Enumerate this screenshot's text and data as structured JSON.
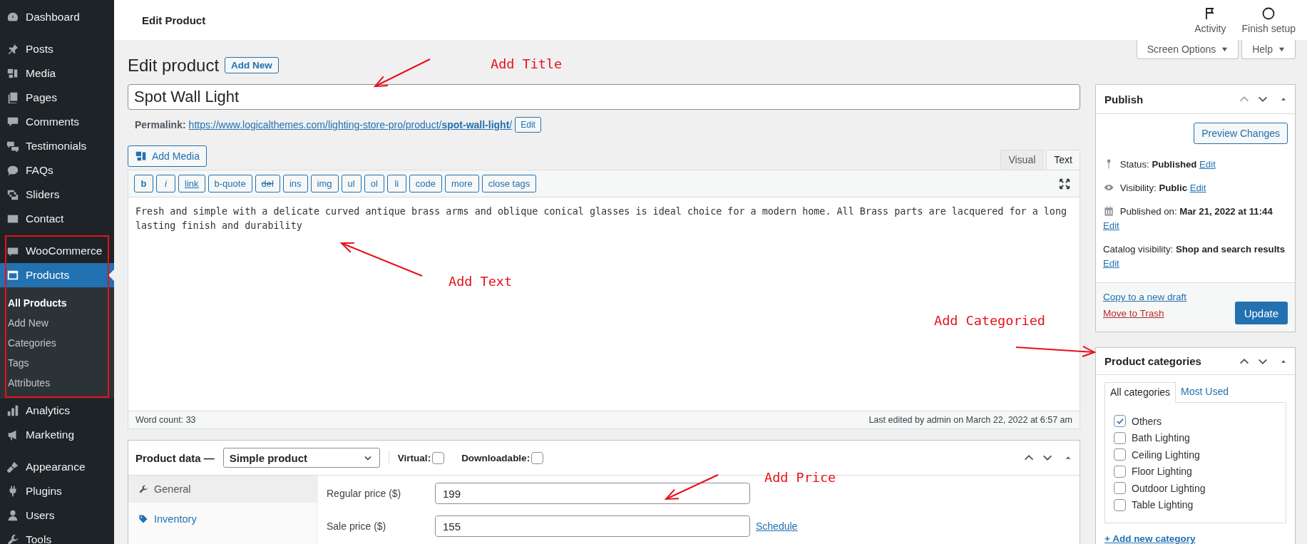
{
  "topbar": {
    "title": "Edit Product",
    "actions": [
      {
        "label": "Activity"
      },
      {
        "label": "Finish setup"
      }
    ]
  },
  "sidebar": {
    "groups": [
      [
        {
          "label": "Dashboard",
          "selected": false
        }
      ],
      [
        {
          "label": "Posts",
          "selected": false
        },
        {
          "label": "Media",
          "selected": false
        },
        {
          "label": "Pages",
          "selected": false
        },
        {
          "label": "Comments",
          "selected": false
        },
        {
          "label": "Testimonials",
          "selected": false
        },
        {
          "label": "FAQs",
          "selected": false
        },
        {
          "label": "Sliders",
          "selected": false
        },
        {
          "label": "Contact",
          "selected": false
        }
      ],
      [
        {
          "label": "WooCommerce",
          "selected": false
        },
        {
          "label": "Products",
          "selected": true,
          "children": [
            {
              "label": "All Products",
              "selected": true
            },
            {
              "label": "Add New",
              "selected": false
            },
            {
              "label": "Categories",
              "selected": false
            },
            {
              "label": "Tags",
              "selected": false
            },
            {
              "label": "Attributes",
              "selected": false
            }
          ]
        },
        {
          "label": "Analytics",
          "selected": false
        },
        {
          "label": "Marketing",
          "selected": false
        }
      ],
      [
        {
          "label": "Appearance",
          "selected": false
        },
        {
          "label": "Plugins",
          "selected": false
        },
        {
          "label": "Users",
          "selected": false
        },
        {
          "label": "Tools",
          "selected": false
        }
      ]
    ]
  },
  "screen_buttons": [
    "Screen Options",
    "Help"
  ],
  "page": {
    "heading": "Edit product",
    "add_new": "Add New"
  },
  "title_field": {
    "value": "Spot Wall Light"
  },
  "permalink": {
    "label": "Permalink:",
    "url": "https://www.logicalthemes.com/lighting-store-pro/product/**spot-wall-light**/",
    "edit": "Edit"
  },
  "editor": {
    "add_media": "Add Media",
    "tabs": [
      {
        "label": "Visual",
        "selected": false
      },
      {
        "label": "Text",
        "selected": true
      }
    ],
    "quicktags": [
      "b",
      "i",
      "link",
      "b-quote",
      "del",
      "ins",
      "img",
      "ul",
      "ol",
      "li",
      "code",
      "more",
      "close tags"
    ],
    "content": "Fresh and simple with a delicate curved antique brass arms and oblique conical glasses is ideal choice for a modern home. All Brass parts are lacquered for a long lasting finish and durability",
    "word_count": "Word count: 33",
    "last_edited": "Last edited by admin on March 22, 2022 at 6:57 am"
  },
  "product_data": {
    "label": "Product data —",
    "type": "Simple product",
    "options": [
      {
        "label": "Virtual:",
        "checked": false
      },
      {
        "label": "Downloadable:",
        "checked": false
      }
    ],
    "tabs": [
      {
        "label": "General",
        "selected": true
      },
      {
        "label": "Inventory",
        "selected": false
      }
    ],
    "fields": [
      {
        "label": "Regular price ($)",
        "value": "199"
      },
      {
        "label": "Sale price ($)",
        "value": "155",
        "link": "Schedule"
      }
    ]
  },
  "publish": {
    "title": "Publish",
    "preview": "Preview Changes",
    "rows": [
      {
        "label": "Status:",
        "value": "Published",
        "edit": "Edit"
      },
      {
        "label": "Visibility:",
        "value": "Public",
        "edit": "Edit"
      },
      {
        "label": "Published on:",
        "value": "Mar 21, 2022 at 11:44",
        "edit": "Edit"
      },
      {
        "label": "Catalog visibility:",
        "value": "Shop and search results",
        "edit": "Edit"
      }
    ],
    "copy_draft": "Copy to a new draft",
    "trash": "Move to Trash",
    "update": "Update"
  },
  "categories": {
    "title": "Product categories",
    "tabs": [
      {
        "label": "All categories",
        "selected": true
      },
      {
        "label": "Most Used",
        "selected": false
      }
    ],
    "items": [
      {
        "label": "Others",
        "checked": true
      },
      {
        "label": "Bath Lighting",
        "checked": false
      },
      {
        "label": "Ceiling Lighting",
        "checked": false
      },
      {
        "label": "Floor Lighting",
        "checked": false
      },
      {
        "label": "Outdoor Lighting",
        "checked": false
      },
      {
        "label": "Table Lighting",
        "checked": false
      }
    ],
    "add": "+ Add new category"
  },
  "annotations": [
    {
      "text": "Add Title"
    },
    {
      "text": "Add Text"
    },
    {
      "text": "Add Categoried"
    },
    {
      "text": "Add Price"
    }
  ]
}
